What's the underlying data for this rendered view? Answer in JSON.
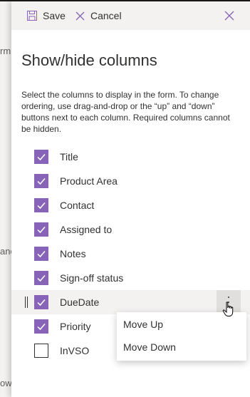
{
  "background": {
    "fragments": [
      "rm",
      "anc",
      "ow"
    ]
  },
  "command_bar": {
    "save_label": "Save",
    "cancel_label": "Cancel"
  },
  "heading": "Show/hide columns",
  "description": "Select the columns to display in the form. To change ordering, use drag-and-drop or the “up” and “down” buttons next to each column. Required columns cannot be hidden.",
  "columns": [
    {
      "label": "Title",
      "checked": true
    },
    {
      "label": "Product Area",
      "checked": true
    },
    {
      "label": "Contact",
      "checked": true
    },
    {
      "label": "Assigned to",
      "checked": true
    },
    {
      "label": "Notes",
      "checked": true
    },
    {
      "label": "Sign-off status",
      "checked": true
    },
    {
      "label": "DueDate",
      "checked": true,
      "active": true
    },
    {
      "label": "Priority",
      "checked": true
    },
    {
      "label": "InVSO",
      "checked": false
    }
  ],
  "context_menu": {
    "move_up": "Move Up",
    "move_down": "Move Down"
  },
  "colors": {
    "accent": "#8764b8",
    "command_bar": "#f3f2f1",
    "text": "#323130"
  }
}
